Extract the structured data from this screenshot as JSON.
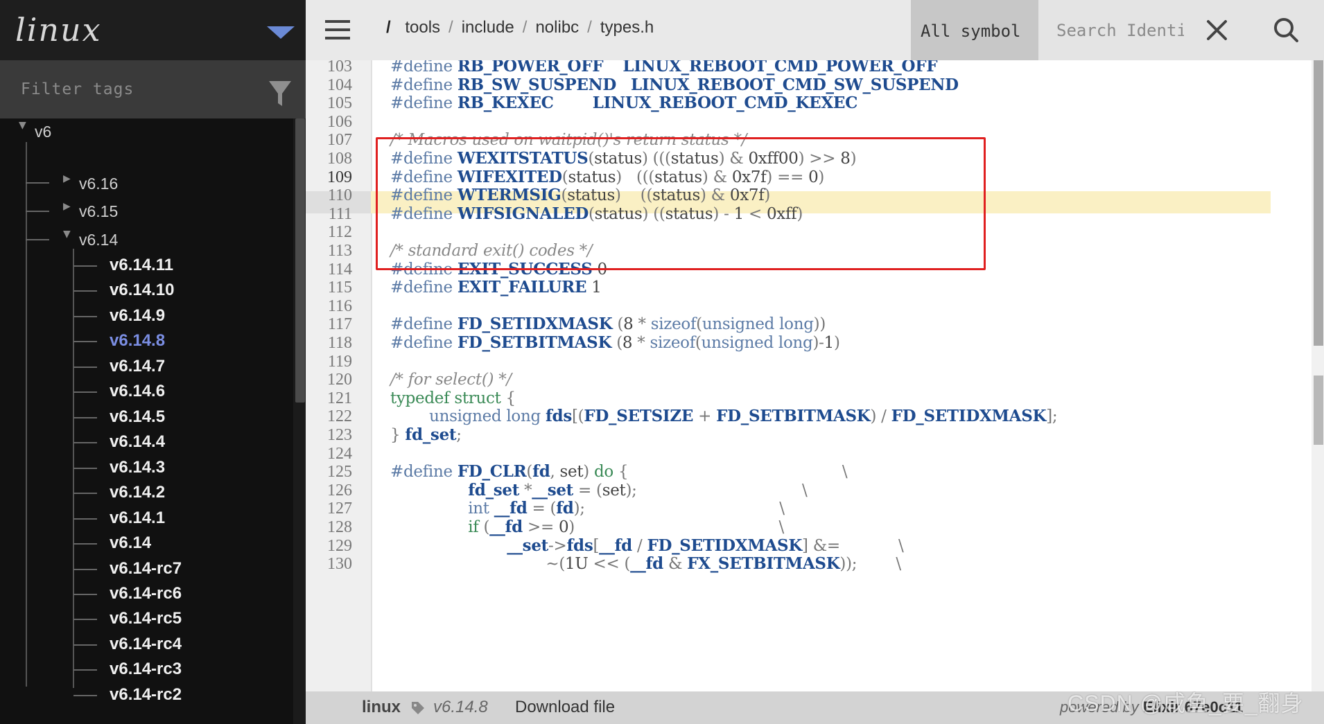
{
  "sidebar": {
    "project": "linux",
    "filter_placeholder": "Filter tags",
    "tree": {
      "root": "v6",
      "groups": [
        "v6.16",
        "v6.15",
        "v6.14"
      ],
      "tags": [
        "v6.14.11",
        "v6.14.10",
        "v6.14.9",
        "v6.14.8",
        "v6.14.7",
        "v6.14.6",
        "v6.14.5",
        "v6.14.4",
        "v6.14.3",
        "v6.14.2",
        "v6.14.1",
        "v6.14",
        "v6.14-rc7",
        "v6.14-rc6",
        "v6.14-rc5",
        "v6.14-rc4",
        "v6.14-rc3",
        "v6.14-rc2"
      ],
      "active_tag": "v6.14.8"
    }
  },
  "topbar": {
    "root": "/",
    "path": [
      "tools",
      "include",
      "nolibc",
      "types.h"
    ],
    "symbol_filter": "All symbol",
    "search_placeholder": "Search Identifier"
  },
  "code": {
    "current_line": 109,
    "lines": [
      {
        "n": 103,
        "t": "#define RB_POWER_OFF    LINUX_REBOOT_CMD_POWER_OFF"
      },
      {
        "n": 104,
        "t": "#define RB_SW_SUSPEND   LINUX_REBOOT_CMD_SW_SUSPEND"
      },
      {
        "n": 105,
        "t": "#define RB_KEXEC        LINUX_REBOOT_CMD_KEXEC"
      },
      {
        "n": 106,
        "t": ""
      },
      {
        "n": 107,
        "t": "/* Macros used on waitpid()'s return status */"
      },
      {
        "n": 108,
        "t": "#define WEXITSTATUS(status) (((status) & 0xff00) >> 8)"
      },
      {
        "n": 109,
        "t": "#define WIFEXITED(status)   (((status) & 0x7f) == 0)"
      },
      {
        "n": 110,
        "t": "#define WTERMSIG(status)    ((status) & 0x7f)"
      },
      {
        "n": 111,
        "t": "#define WIFSIGNALED(status) ((status) - 1 < 0xff)"
      },
      {
        "n": 112,
        "t": ""
      },
      {
        "n": 113,
        "t": "/* standard exit() codes */"
      },
      {
        "n": 114,
        "t": "#define EXIT_SUCCESS 0"
      },
      {
        "n": 115,
        "t": "#define EXIT_FAILURE 1"
      },
      {
        "n": 116,
        "t": ""
      },
      {
        "n": 117,
        "t": "#define FD_SETIDXMASK (8 * sizeof(unsigned long))"
      },
      {
        "n": 118,
        "t": "#define FD_SETBITMASK (8 * sizeof(unsigned long)-1)"
      },
      {
        "n": 119,
        "t": ""
      },
      {
        "n": 120,
        "t": "/* for select() */"
      },
      {
        "n": 121,
        "t": "typedef struct {"
      },
      {
        "n": 122,
        "t": "        unsigned long fds[(FD_SETSIZE + FD_SETBITMASK) / FD_SETIDXMASK];"
      },
      {
        "n": 123,
        "t": "} fd_set;"
      },
      {
        "n": 124,
        "t": ""
      },
      {
        "n": 125,
        "t": "#define FD_CLR(fd, set) do {                                            \\"
      },
      {
        "n": 126,
        "t": "                fd_set *__set = (set);                                  \\"
      },
      {
        "n": 127,
        "t": "                int __fd = (fd);                                        \\"
      },
      {
        "n": 128,
        "t": "                if (__fd >= 0)                                          \\"
      },
      {
        "n": 129,
        "t": "                        __set->fds[__fd / FD_SETIDXMASK] &=            \\"
      },
      {
        "n": 130,
        "t": "                                ~(1U << (__fd & FX_SETBITMASK));        \\"
      }
    ]
  },
  "footer": {
    "project": "linux",
    "version": "v6.14.8",
    "download": "Download file",
    "powered_by": "powered by",
    "engine": "Elixir 67e0c11"
  },
  "watermark": "CSDN @咸鱼_要_翻身",
  "colors": {
    "sidebar_bg": "#111111",
    "active_tag": "#7b8ee3",
    "highlight": "#faf0c4",
    "annotation_box": "#e02020"
  }
}
